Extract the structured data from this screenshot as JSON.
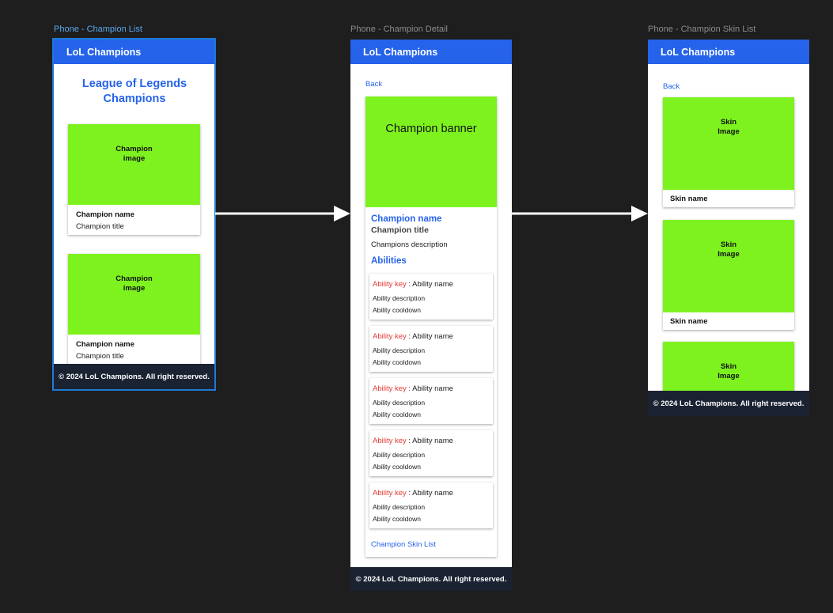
{
  "frames": {
    "list_label": "Phone - Champion List",
    "detail_label": "Phone - Champion Detail",
    "skins_label": "Phone - Champion Skin List"
  },
  "app": {
    "header_title": "LoL Champions",
    "footer_text": "© 2024 LoL Champions. All right reserved."
  },
  "list": {
    "page_title": "League of Legends Champions",
    "cards": [
      {
        "image_label": "Champion\nimage",
        "name": "Champion name",
        "title": "Champion title"
      },
      {
        "image_label": "Champion\nimage",
        "name": "Champion name",
        "title": "Champion title"
      }
    ]
  },
  "detail": {
    "back": "Back",
    "banner": "Champion banner",
    "name": "Champion name",
    "title": "Champion title",
    "description": "Champions description",
    "abilities_heading": "Abilities",
    "abilities": [
      {
        "key": "Ability key",
        "name": " : Ability name",
        "description": "Ability description",
        "cooldown": "Ability cooldown"
      },
      {
        "key": "Ability key",
        "name": " : Ability name",
        "description": "Ability description",
        "cooldown": "Ability cooldown"
      },
      {
        "key": "Ability key",
        "name": " : Ability name",
        "description": "Ability description",
        "cooldown": "Ability cooldown"
      },
      {
        "key": "Ability key",
        "name": " : Ability name",
        "description": "Ability description",
        "cooldown": "Ability cooldown"
      },
      {
        "key": "Ability key",
        "name": " : Ability name",
        "description": "Ability description",
        "cooldown": "Ability cooldown"
      }
    ],
    "skin_list_link": "Champion Skin List"
  },
  "skins": {
    "back": "Back",
    "items": [
      {
        "image_label": "Skin\nImage",
        "name": "Skin name"
      },
      {
        "image_label": "Skin\nImage",
        "name": "Skin name"
      },
      {
        "image_label": "Skin\nImage"
      }
    ]
  },
  "colors": {
    "accent": "#2563eb",
    "placeholder": "#7ef21f",
    "footer": "#1b2333",
    "ability_key": "#e53935",
    "canvas": "#1e1e1e"
  }
}
